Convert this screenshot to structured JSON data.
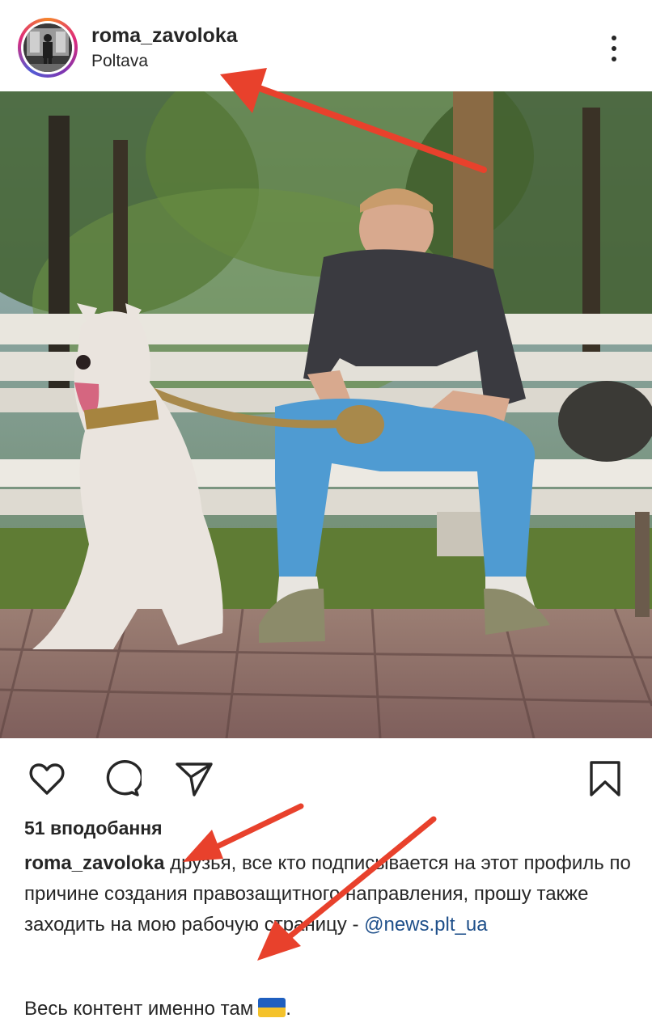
{
  "post": {
    "username": "roma_zavoloka",
    "location": "Poltava",
    "likes": "51 вподобання",
    "caption": {
      "author": "roma_zavoloka",
      "text": " друзья, все кто подписывается на этот профиль по причине создания правозащитного направления, прошу  также заходить на мою рабочую страницу - ",
      "mention": "@news.plt_ua",
      "line2": "Весь контент именно там"
    }
  },
  "icons": {
    "more": "more-vertical-icon",
    "like": "heart-icon",
    "comment": "comment-icon",
    "share": "send-icon",
    "save": "bookmark-icon"
  },
  "colors": {
    "text": "#262626",
    "mention": "#1e4f8a",
    "annotation_arrow": "#e8412c",
    "flag_blue": "#1f5fbf",
    "flag_yellow": "#f4c22b"
  }
}
